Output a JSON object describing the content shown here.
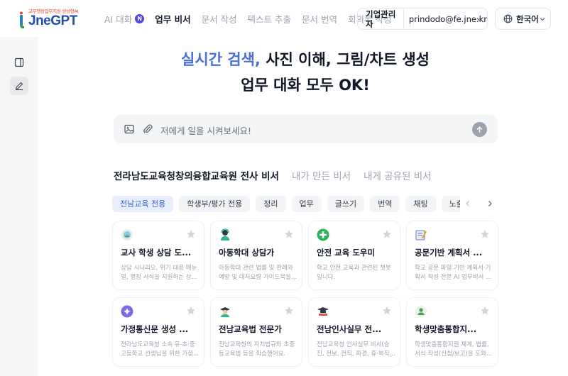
{
  "brand": {
    "tagline": "교무행정업무지원 생성형AI",
    "name": "JneGPT"
  },
  "nav": [
    {
      "label": "AI 대화",
      "badge": "N",
      "active": false
    },
    {
      "label": "업무 비서",
      "active": true
    },
    {
      "label": "문서 작성",
      "active": false
    },
    {
      "label": "텍스트 추출",
      "active": false
    },
    {
      "label": "문서 번역",
      "active": false
    },
    {
      "label": "회의록 작성",
      "active": false
    }
  ],
  "user": {
    "role": "기업관리자",
    "email": "prindodo@fe.jne.kr"
  },
  "language": {
    "label": "한국어"
  },
  "hero": {
    "accent": "실시간 검색,",
    "line1_rest": " 사진 이해, 그림/차트 생성",
    "line2": "업무 대화 모두 OK!"
  },
  "input": {
    "placeholder": "저에게 일을 시켜보세요!"
  },
  "tabs": [
    {
      "label": "전라남도교육청창의융합교육원 전사 비서",
      "active": true
    },
    {
      "label": "내가 만든 비서",
      "active": false
    },
    {
      "label": "내게 공유된 비서",
      "active": false
    }
  ],
  "chips": [
    "전남교육 전용",
    "학생부/평가 전용",
    "정리",
    "업무",
    "글쓰기",
    "번역",
    "채팅",
    "노출 대기중"
  ],
  "cards": [
    {
      "title": "교사 학생 상담 도...",
      "desc": "상담 시나리오, 위기 대응 매뉴얼, 행정 서식을 지원하는 상...",
      "icon": "counsel-icon"
    },
    {
      "title": "아동학대 상담가",
      "desc": "아동학대 관련 법률 및 판례와 예방 및 대처요령 가이드북을...",
      "icon": "counselor-icon"
    },
    {
      "title": "안전 교육 도우미",
      "desc": "학교 안전 교육과 관련된 챗봇입니다.",
      "icon": "plus-icon"
    },
    {
      "title": "공문기반 계획서 ...",
      "desc": "학교 공문 파일 기반 계획서·기획서 작성 전문 AI 업무비서 ...",
      "icon": "document-icon"
    },
    {
      "title": "가정통신문 생성 ...",
      "desc": "전라남도교육청 소속 유·초·중·고등학교 선생님을 위한 가정...",
      "icon": "sparkle-icon"
    },
    {
      "title": "전남교육법 전문가",
      "desc": "전남교육청의 자치법규와 초중등교육법 등을 학습했어요.",
      "icon": "scholar-icon"
    },
    {
      "title": "전남인사실무 전...",
      "desc": "전남교육청 인사실무 비서(승진, 전보, 전직, 파견, 휴·복직...",
      "icon": "graduation-icon"
    },
    {
      "title": "학생맞춤통합지...",
      "desc": "학생맞춤통합지원 체계, 법률, 서식 작성(신청/보고)을 도와...",
      "icon": "support-icon"
    }
  ],
  "colors": {
    "accent": "#4a6ee0",
    "chip_active_bg": "#e8eefc",
    "brand_blue": "#1f4fa8",
    "brand_red": "#e24a2a"
  }
}
